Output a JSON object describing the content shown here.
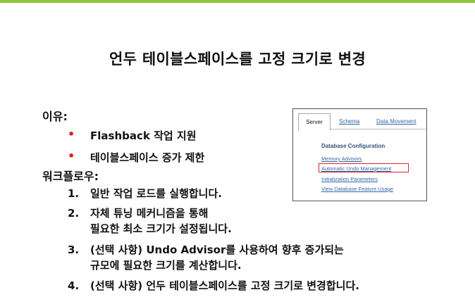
{
  "slide": {
    "title": "언두 테이블스페이스를 고정 크기로 변경",
    "reason_heading": "이유:",
    "reasons": [
      "Flashback 작업 지원",
      "테이블스페이스 증가 제한"
    ],
    "bullet_symbol": "•",
    "workflow_heading": "워크플로우:",
    "steps": [
      {
        "num": "1.",
        "line1": "일반 작업 로드를 실행합니다.",
        "line2": ""
      },
      {
        "num": "2.",
        "line1": "자체 튜닝 메커니즘을 통해",
        "line2": "필요한 최소 크기가 설정됩니다."
      },
      {
        "num": "3.",
        "line1": "(선택 사항) Undo Advisor를 사용하여 향후 증가되는",
        "line2": "규모에 필요한 크기를 계산합니다."
      },
      {
        "num": "4.",
        "line1": "(선택 사항) 언두 테이블스페이스를 고정 크기로 변경합니다.",
        "line2": ""
      }
    ]
  },
  "screenshot": {
    "tabs": [
      "Server",
      "Schema",
      "Data Movement"
    ],
    "section_heading": "Database Configuration",
    "links": [
      "Memory Advisors",
      "Automatic Undo Management",
      "Initialization Parameters",
      "View Database Feature Usage"
    ],
    "highlight_color": "#d9262b"
  },
  "colors": {
    "accent_bar": "#8cc63e",
    "bullet": "#e21b1b"
  }
}
